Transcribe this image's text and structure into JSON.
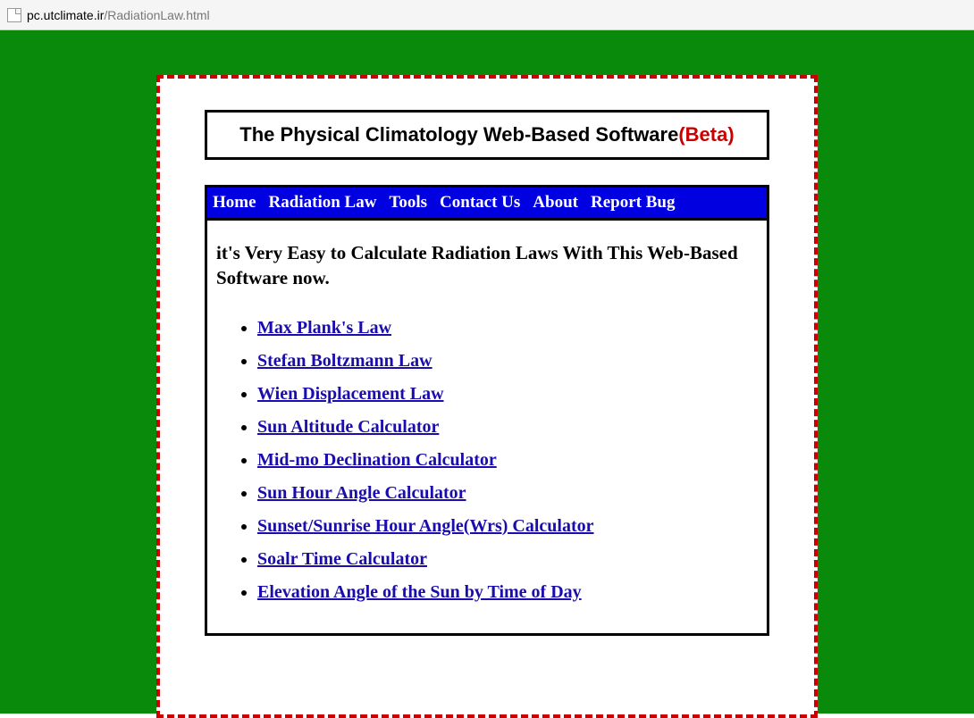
{
  "browser": {
    "host": "pc.utclimate.ir",
    "path": "/RadiationLaw.html"
  },
  "header": {
    "title_main": "The Physical Climatology Web-Based Software",
    "title_beta": "(Beta)"
  },
  "nav": {
    "items": [
      {
        "label": "Home"
      },
      {
        "label": "Radiation Law"
      },
      {
        "label": "Tools"
      },
      {
        "label": "Contact Us"
      },
      {
        "label": "About"
      },
      {
        "label": "Report Bug"
      }
    ]
  },
  "main": {
    "intro": "it's Very Easy to Calculate Radiation Laws With This Web-Based Software now.",
    "links": [
      {
        "label": "Max Plank's Law"
      },
      {
        "label": "Stefan Boltzmann Law"
      },
      {
        "label": "Wien Displacement Law"
      },
      {
        "label": "Sun Altitude Calculator"
      },
      {
        "label": "Mid-mo Declination Calculator"
      },
      {
        "label": "Sun Hour Angle Calculator"
      },
      {
        "label": "Sunset/Sunrise Hour Angle(Wrs) Calculator"
      },
      {
        "label": "Soalr Time Calculator"
      },
      {
        "label": "Elevation Angle of the Sun by Time of Day"
      }
    ]
  }
}
